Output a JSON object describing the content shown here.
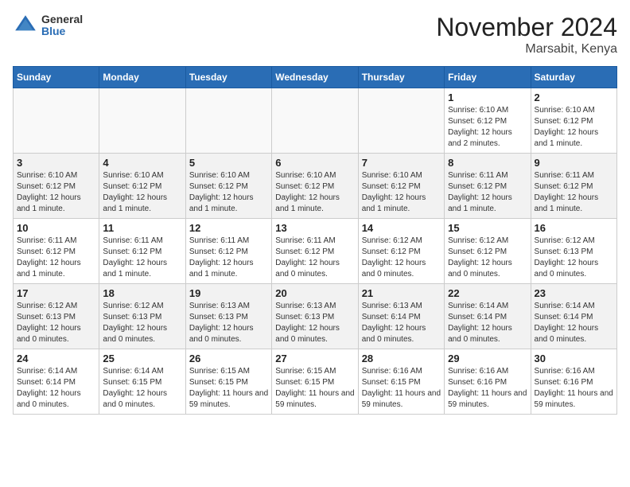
{
  "logo": {
    "general": "General",
    "blue": "Blue"
  },
  "title": "November 2024",
  "location": "Marsabit, Kenya",
  "weekdays": [
    "Sunday",
    "Monday",
    "Tuesday",
    "Wednesday",
    "Thursday",
    "Friday",
    "Saturday"
  ],
  "weeks": [
    [
      {
        "day": "",
        "info": ""
      },
      {
        "day": "",
        "info": ""
      },
      {
        "day": "",
        "info": ""
      },
      {
        "day": "",
        "info": ""
      },
      {
        "day": "",
        "info": ""
      },
      {
        "day": "1",
        "info": "Sunrise: 6:10 AM\nSunset: 6:12 PM\nDaylight: 12 hours and 2 minutes."
      },
      {
        "day": "2",
        "info": "Sunrise: 6:10 AM\nSunset: 6:12 PM\nDaylight: 12 hours and 1 minute."
      }
    ],
    [
      {
        "day": "3",
        "info": "Sunrise: 6:10 AM\nSunset: 6:12 PM\nDaylight: 12 hours and 1 minute."
      },
      {
        "day": "4",
        "info": "Sunrise: 6:10 AM\nSunset: 6:12 PM\nDaylight: 12 hours and 1 minute."
      },
      {
        "day": "5",
        "info": "Sunrise: 6:10 AM\nSunset: 6:12 PM\nDaylight: 12 hours and 1 minute."
      },
      {
        "day": "6",
        "info": "Sunrise: 6:10 AM\nSunset: 6:12 PM\nDaylight: 12 hours and 1 minute."
      },
      {
        "day": "7",
        "info": "Sunrise: 6:10 AM\nSunset: 6:12 PM\nDaylight: 12 hours and 1 minute."
      },
      {
        "day": "8",
        "info": "Sunrise: 6:11 AM\nSunset: 6:12 PM\nDaylight: 12 hours and 1 minute."
      },
      {
        "day": "9",
        "info": "Sunrise: 6:11 AM\nSunset: 6:12 PM\nDaylight: 12 hours and 1 minute."
      }
    ],
    [
      {
        "day": "10",
        "info": "Sunrise: 6:11 AM\nSunset: 6:12 PM\nDaylight: 12 hours and 1 minute."
      },
      {
        "day": "11",
        "info": "Sunrise: 6:11 AM\nSunset: 6:12 PM\nDaylight: 12 hours and 1 minute."
      },
      {
        "day": "12",
        "info": "Sunrise: 6:11 AM\nSunset: 6:12 PM\nDaylight: 12 hours and 1 minute."
      },
      {
        "day": "13",
        "info": "Sunrise: 6:11 AM\nSunset: 6:12 PM\nDaylight: 12 hours and 0 minutes."
      },
      {
        "day": "14",
        "info": "Sunrise: 6:12 AM\nSunset: 6:12 PM\nDaylight: 12 hours and 0 minutes."
      },
      {
        "day": "15",
        "info": "Sunrise: 6:12 AM\nSunset: 6:12 PM\nDaylight: 12 hours and 0 minutes."
      },
      {
        "day": "16",
        "info": "Sunrise: 6:12 AM\nSunset: 6:13 PM\nDaylight: 12 hours and 0 minutes."
      }
    ],
    [
      {
        "day": "17",
        "info": "Sunrise: 6:12 AM\nSunset: 6:13 PM\nDaylight: 12 hours and 0 minutes."
      },
      {
        "day": "18",
        "info": "Sunrise: 6:12 AM\nSunset: 6:13 PM\nDaylight: 12 hours and 0 minutes."
      },
      {
        "day": "19",
        "info": "Sunrise: 6:13 AM\nSunset: 6:13 PM\nDaylight: 12 hours and 0 minutes."
      },
      {
        "day": "20",
        "info": "Sunrise: 6:13 AM\nSunset: 6:13 PM\nDaylight: 12 hours and 0 minutes."
      },
      {
        "day": "21",
        "info": "Sunrise: 6:13 AM\nSunset: 6:14 PM\nDaylight: 12 hours and 0 minutes."
      },
      {
        "day": "22",
        "info": "Sunrise: 6:14 AM\nSunset: 6:14 PM\nDaylight: 12 hours and 0 minutes."
      },
      {
        "day": "23",
        "info": "Sunrise: 6:14 AM\nSunset: 6:14 PM\nDaylight: 12 hours and 0 minutes."
      }
    ],
    [
      {
        "day": "24",
        "info": "Sunrise: 6:14 AM\nSunset: 6:14 PM\nDaylight: 12 hours and 0 minutes."
      },
      {
        "day": "25",
        "info": "Sunrise: 6:14 AM\nSunset: 6:15 PM\nDaylight: 12 hours and 0 minutes."
      },
      {
        "day": "26",
        "info": "Sunrise: 6:15 AM\nSunset: 6:15 PM\nDaylight: 11 hours and 59 minutes."
      },
      {
        "day": "27",
        "info": "Sunrise: 6:15 AM\nSunset: 6:15 PM\nDaylight: 11 hours and 59 minutes."
      },
      {
        "day": "28",
        "info": "Sunrise: 6:16 AM\nSunset: 6:15 PM\nDaylight: 11 hours and 59 minutes."
      },
      {
        "day": "29",
        "info": "Sunrise: 6:16 AM\nSunset: 6:16 PM\nDaylight: 11 hours and 59 minutes."
      },
      {
        "day": "30",
        "info": "Sunrise: 6:16 AM\nSunset: 6:16 PM\nDaylight: 11 hours and 59 minutes."
      }
    ]
  ]
}
